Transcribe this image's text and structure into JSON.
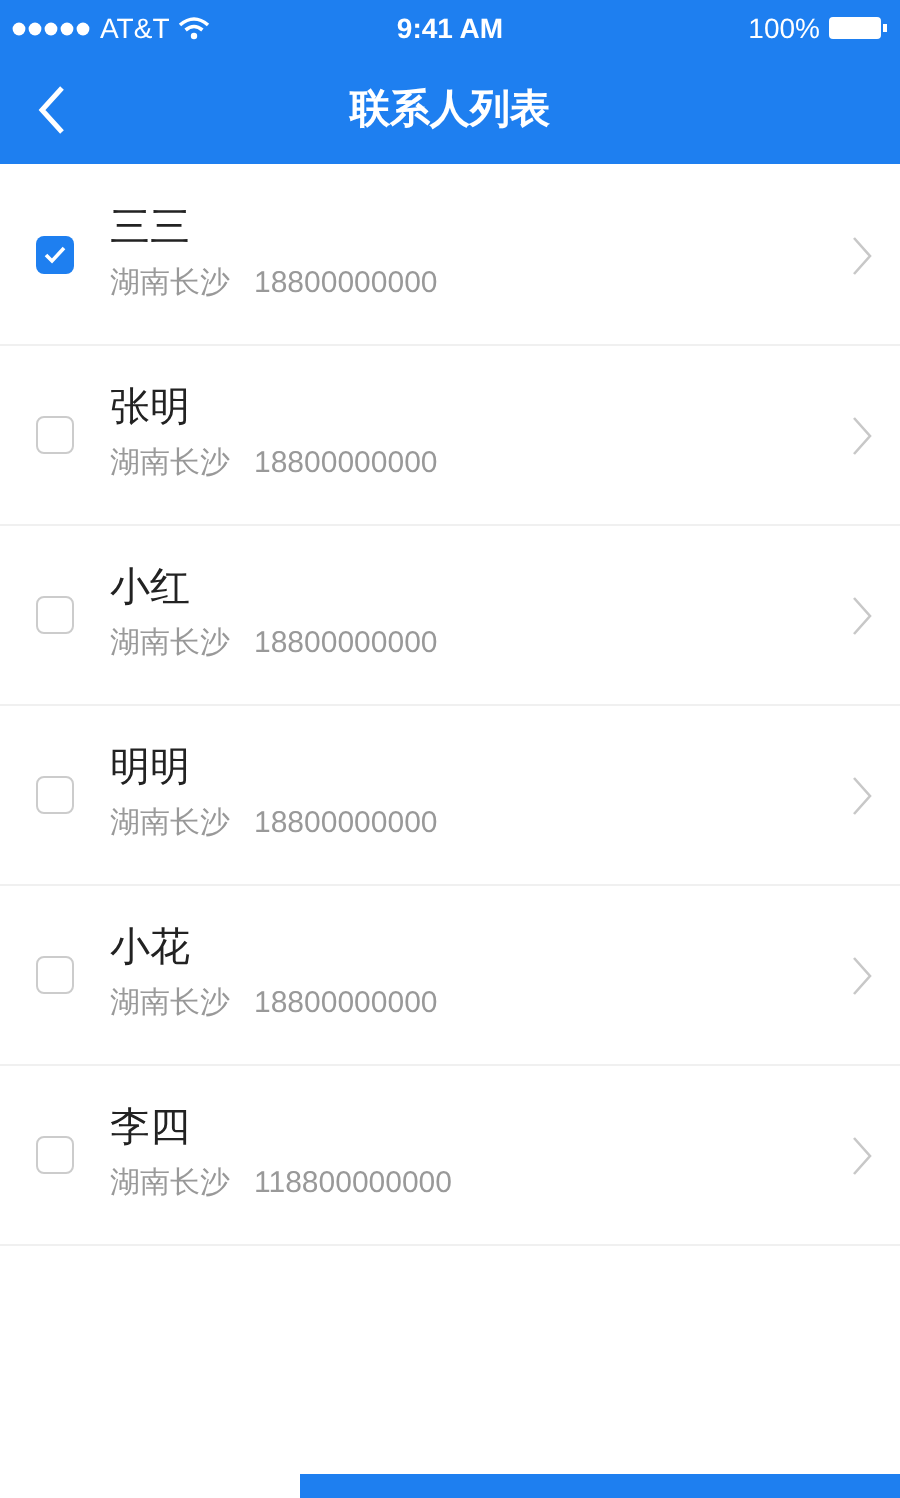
{
  "status_bar": {
    "carrier": "AT&T",
    "time": "9:41 AM",
    "battery": "100%"
  },
  "nav": {
    "title": "联系人列表"
  },
  "contacts": [
    {
      "name": "三三",
      "location": "湖南长沙",
      "phone": "18800000000",
      "checked": true
    },
    {
      "name": "张明",
      "location": "湖南长沙",
      "phone": "18800000000",
      "checked": false
    },
    {
      "name": "小红",
      "location": "湖南长沙",
      "phone": "18800000000",
      "checked": false
    },
    {
      "name": "明明",
      "location": "湖南长沙",
      "phone": "18800000000",
      "checked": false
    },
    {
      "name": "小花",
      "location": "湖南长沙",
      "phone": "18800000000",
      "checked": false
    },
    {
      "name": "李四",
      "location": "湖南长沙",
      "phone": "118800000000",
      "checked": false
    }
  ]
}
